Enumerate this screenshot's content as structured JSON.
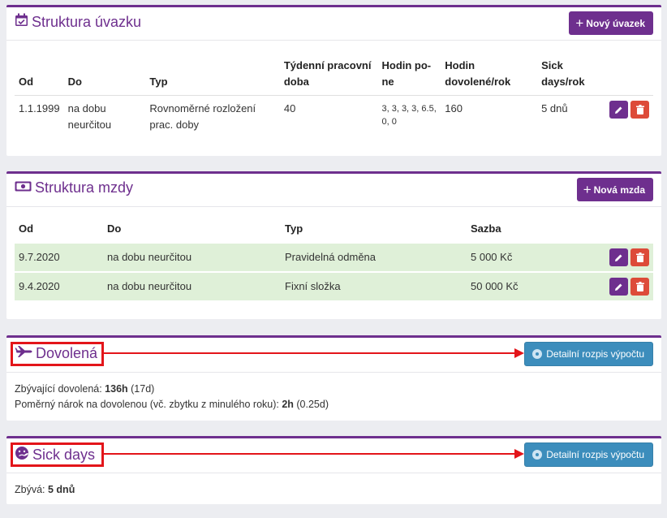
{
  "uvazek": {
    "title": "Struktura úvazku",
    "add_button": "Nový úvazek",
    "columns": [
      "Od",
      "Do",
      "Typ",
      "Týdenní pracovní doba",
      "Hodin po-ne",
      "Hodin dovolené/rok",
      "Sick days/rok"
    ],
    "columns_display": {
      "od": "Od",
      "do": "Do",
      "typ": "Typ",
      "tydenni_1": "Týdenní pracovní",
      "tydenni_2": "doba",
      "hodin_1": "Hodin po-",
      "hodin_2": "ne",
      "dovolene_1": "Hodin",
      "dovolene_2": "dovolené/rok",
      "sick_1": "Sick",
      "sick_2": "days/rok"
    },
    "rows": [
      {
        "od": "1.1.1999",
        "do_1": "na dobu",
        "do_2": "neurčitou",
        "typ_1": "Rovnoměrné rozložení",
        "typ_2": "prac. doby",
        "tydenni": "40",
        "hodin_1": "3, 3, 3, 3, 6.5,",
        "hodin_2": "0, 0",
        "dovolene": "160",
        "sick": "5 dnů"
      }
    ]
  },
  "mzda": {
    "title": "Struktura mzdy",
    "add_button": "Nová mzda",
    "columns": {
      "od": "Od",
      "do": "Do",
      "typ": "Typ",
      "sazba": "Sazba"
    },
    "rows": [
      {
        "od": "9.7.2020",
        "do": "na dobu neurčitou",
        "typ": "Pravidelná odměna",
        "sazba": "5 000 Kč"
      },
      {
        "od": "9.4.2020",
        "do": "na dobu neurčitou",
        "typ": "Fixní složka",
        "sazba": "50 000 Kč"
      }
    ]
  },
  "dovolena": {
    "title": "Dovolená",
    "detail_button": "Detailní rozpis výpočtu",
    "line1_label": "Zbývající dovolená: ",
    "line1_value": "136h",
    "line1_suffix": " (17d)",
    "line2_label": "Poměrný nárok na dovolenou (vč. zbytku z minulého roku): ",
    "line2_value": "2h",
    "line2_suffix": " (0.25d)"
  },
  "sick": {
    "title": "Sick days",
    "detail_button": "Detailní rozpis výpočtu",
    "line_label": "Zbývá: ",
    "line_value": "5 dnů"
  },
  "colors": {
    "accent": "#6e2f8e",
    "danger": "#dd4b39",
    "info": "#3c8dbc",
    "row_success": "#dff0d8",
    "annotation": "#e3151a"
  },
  "icons": [
    "calendar-check-icon",
    "money-bill-icon",
    "plane-icon",
    "face-sick-icon",
    "plus-icon",
    "pencil-icon",
    "trash-icon",
    "eye-icon"
  ]
}
